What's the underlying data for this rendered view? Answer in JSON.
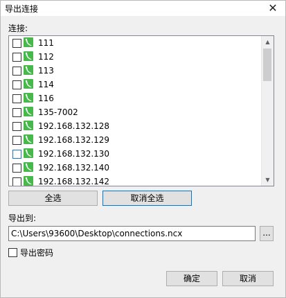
{
  "window": {
    "title": "导出连接",
    "close_glyph": "✕"
  },
  "connections": {
    "label": "连接:",
    "items": [
      {
        "name": "111",
        "checked": false
      },
      {
        "name": "112",
        "checked": false
      },
      {
        "name": "113",
        "checked": false
      },
      {
        "name": "114",
        "checked": false
      },
      {
        "name": "116",
        "checked": false
      },
      {
        "name": "135-7002",
        "checked": false
      },
      {
        "name": "192.168.132.128",
        "checked": false
      },
      {
        "name": "192.168.132.129",
        "checked": false
      },
      {
        "name": "192.168.132.130",
        "checked": false
      },
      {
        "name": "192.168.132.140",
        "checked": false
      },
      {
        "name": "192.168.132.142",
        "checked": false
      }
    ],
    "icon": "connection-icon",
    "icon_color": "#47b84a",
    "scroll_up_glyph": "▲",
    "scroll_down_glyph": "▼"
  },
  "buttons": {
    "select_all": "全选",
    "deselect_all": "取消全选",
    "browse": "...",
    "ok": "确定",
    "cancel": "取消"
  },
  "export": {
    "label": "导出到:",
    "path": "C:\\Users\\93600\\Desktop\\connections.ncx"
  },
  "options": {
    "export_password_label": "导出密码",
    "export_password_checked": false
  }
}
